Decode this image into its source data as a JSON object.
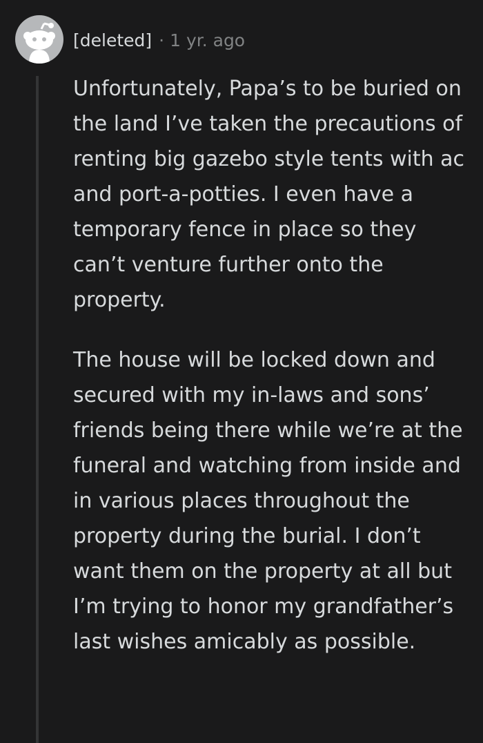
{
  "comment": {
    "author": "[deleted]",
    "separator": "·",
    "timestamp": "1 yr. ago",
    "avatar_icon": "reddit-snoo-icon",
    "paragraphs": [
      "Unfortunately, Papa’s to be buried on the land I’ve taken the precautions of renting big gazebo style tents with ac and port-a-potties. I even have a temporary fence in place so they can’t venture further onto the property.",
      "The house will be locked down and secured with my in-laws and sons’ friends being there while we’re at the funeral and watching from inside and in various places throughout the property during the burial. I don’t want them on the property at all but I’m trying to honor my grandfather’s last wishes amicably as possible."
    ]
  },
  "colors": {
    "background": "#1a1a1b",
    "text": "#d7dadc",
    "muted": "#818384",
    "thread_line": "#343536",
    "avatar_bg": "#b6b8ba"
  }
}
